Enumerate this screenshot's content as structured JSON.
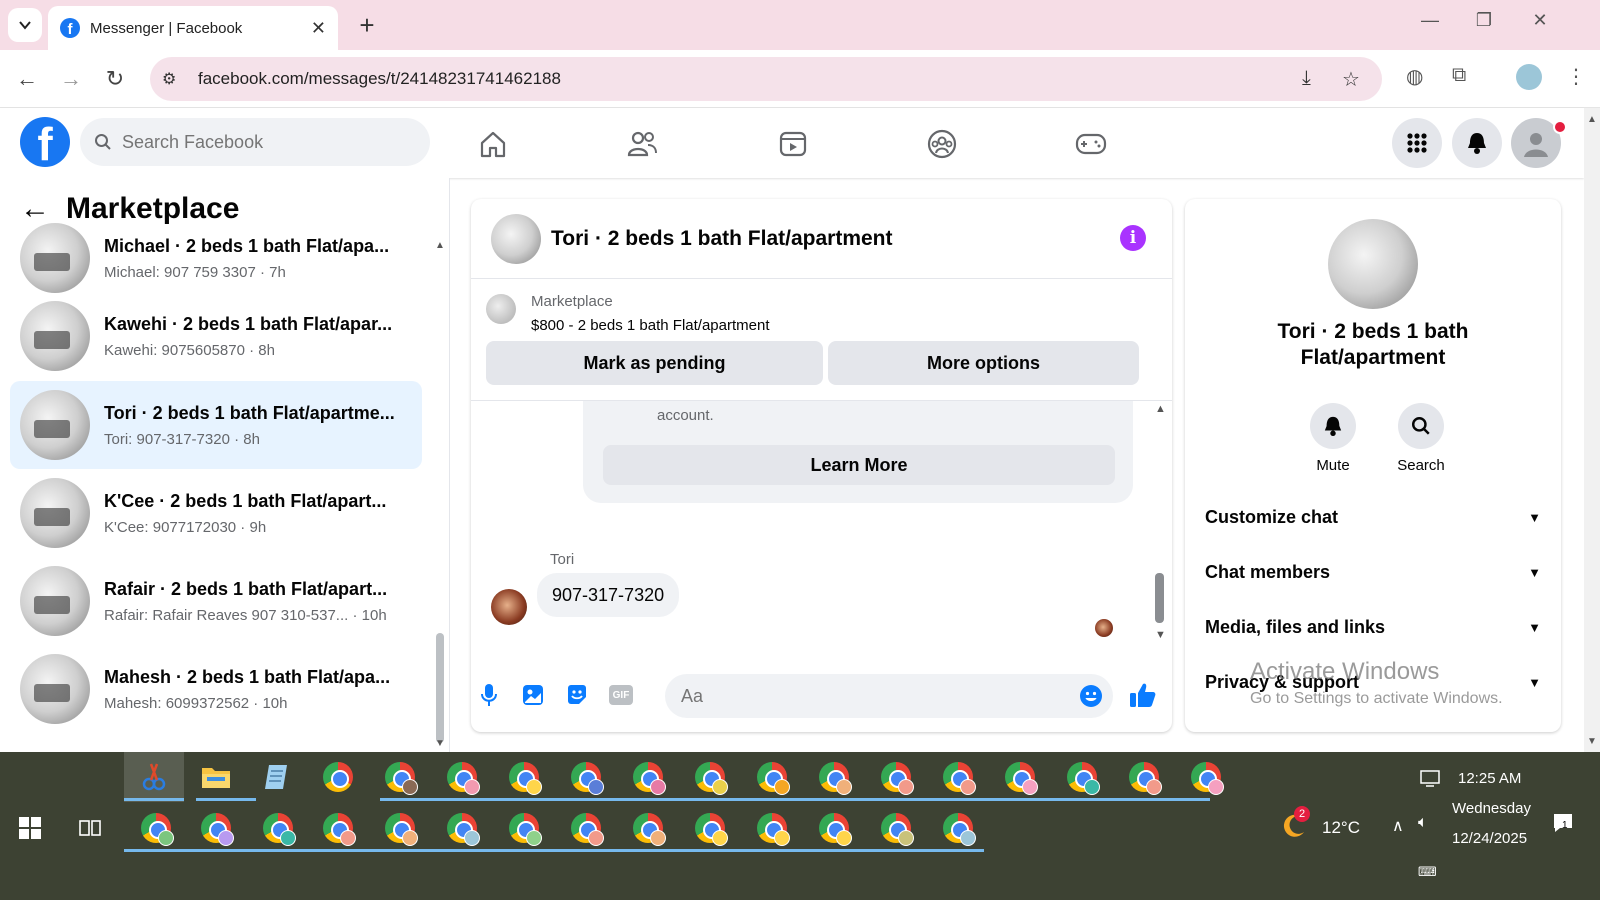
{
  "browser": {
    "tab_title": "Messenger | Facebook",
    "url": "facebook.com/messages/t/24148231741462188",
    "new_tab": "+",
    "close_tab": "✕"
  },
  "facebook": {
    "search_placeholder": "Search Facebook",
    "logo_letter": "f"
  },
  "left_panel": {
    "title": "Marketplace",
    "conversations": [
      {
        "name": "Michael · 2 beds 1 bath Flat/apa...",
        "preview": "Michael: 907 759 3307 · 7h"
      },
      {
        "name": "Kawehi · 2 beds 1 bath Flat/apar...",
        "preview": "Kawehi: 9075605870 · 8h"
      },
      {
        "name": "Tori · 2 beds 1 bath Flat/apartme...",
        "preview": "Tori: 907-317-7320 · 8h"
      },
      {
        "name": "K'Cee · 2 beds 1 bath Flat/apart...",
        "preview": "K'Cee: 9077172030 · 9h"
      },
      {
        "name": "Rafair · 2 beds 1 bath Flat/apart...",
        "preview": "Rafair: Rafair Reaves 907 310-537...  · 10h"
      },
      {
        "name": "Mahesh · 2 beds 1 bath Flat/apa...",
        "preview": "Mahesh: 6099372562 · 10h"
      }
    ]
  },
  "chat": {
    "title": "Tori · 2 beds 1 bath Flat/apartment",
    "info_icon": "i",
    "marketplace_label": "Marketplace",
    "listing": "$800 - 2 beds 1 bath Flat/apartment",
    "mark_pending": "Mark as pending",
    "more_options": "More options",
    "info_text_tail": "account.",
    "learn_more": "Learn More",
    "sender": "Tori",
    "message": "907-317-7320",
    "composer_placeholder": "Aa",
    "gif_label": "GIF"
  },
  "right_panel": {
    "name_line1": "Tori · 2 beds 1 bath",
    "name_line2": "Flat/apartment",
    "mute": "Mute",
    "search": "Search",
    "items": [
      "Customize chat",
      "Chat members",
      "Media, files and links",
      "Privacy & support"
    ]
  },
  "watermark": {
    "line1": "Activate Windows",
    "line2": "Go to Settings to activate Windows."
  },
  "taskbar": {
    "time": "12:25 AM",
    "day": "Wednesday",
    "date": "12/24/2025",
    "temp": "12°C",
    "weather_badge": "2",
    "notif_count": "1"
  },
  "colors": {
    "fb_blue": "#1877f2",
    "active_conv": "#e7f3ff",
    "messenger_purple": "#a933ff",
    "chrome_tab_strip": "#f6dde6",
    "taskbar": "#3d4233"
  }
}
